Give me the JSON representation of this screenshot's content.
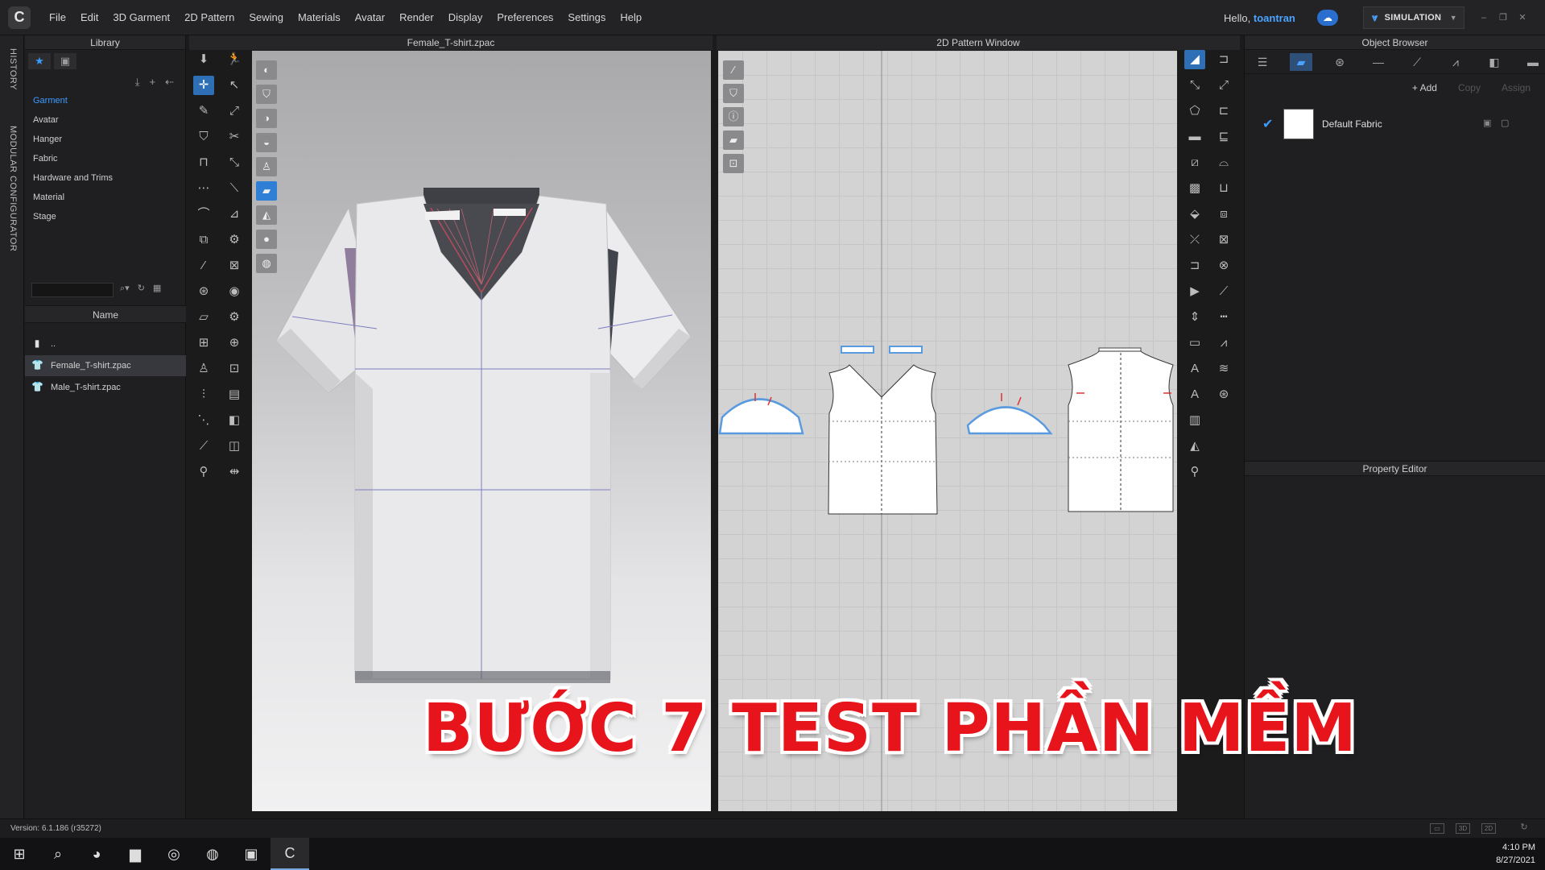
{
  "menubar": {
    "logo": "C",
    "items": [
      "File",
      "Edit",
      "3D Garment",
      "2D Pattern",
      "Sewing",
      "Materials",
      "Avatar",
      "Render",
      "Display",
      "Preferences",
      "Settings",
      "Help"
    ],
    "greeting": "Hello,",
    "username": "toantran",
    "mode": "SIMULATION"
  },
  "side_tabs": [
    "HISTORY",
    "MODULAR CONFIGURATOR"
  ],
  "library": {
    "title": "Library",
    "categories": [
      "Garment",
      "Avatar",
      "Hanger",
      "Fabric",
      "Hardware and Trims",
      "Material",
      "Stage"
    ],
    "active_category": "Garment",
    "name_header": "Name",
    "files": [
      "..",
      "Female_T-shirt.zpac",
      "Male_T-shirt.zpac"
    ],
    "selected_file": "Female_T-shirt.zpac"
  },
  "view3d": {
    "title": "Female_T-shirt.zpac"
  },
  "view2d": {
    "title": "2D Pattern Window"
  },
  "object_browser": {
    "title": "Object Browser",
    "actions": {
      "add": "+ Add",
      "copy": "Copy",
      "assign": "Assign"
    },
    "fabric_name": "Default Fabric"
  },
  "property_editor": {
    "title": "Property Editor"
  },
  "status": {
    "version": "Version: 6.1.186 (r35272)"
  },
  "taskbar": {
    "time": "4:10 PM",
    "date": "8/27/2021"
  },
  "caption": "BƯỚC 7 TEST PHẦN MỀM",
  "colors": {
    "accent": "#3b9cff",
    "caption": "#e8141b",
    "selection": "#2f6fb5"
  }
}
